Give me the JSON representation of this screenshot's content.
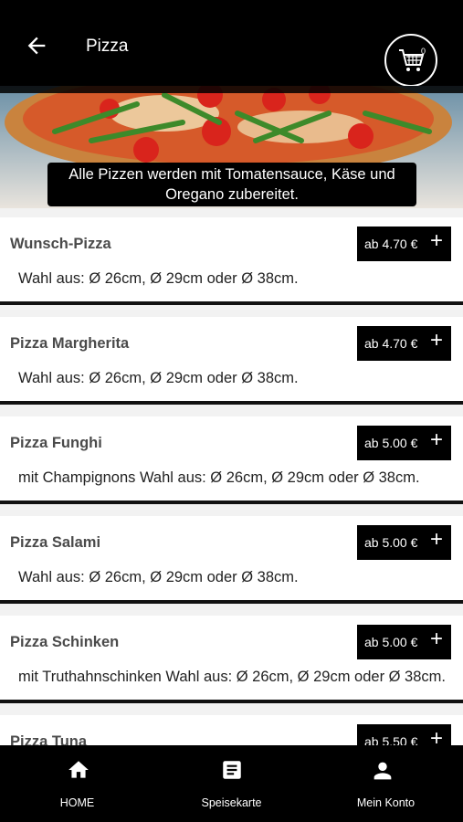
{
  "header": {
    "title": "Pizza",
    "cart_count": "0"
  },
  "banner": {
    "line1": "Alle Pizzen werden mit Tomatensauce, Käse und",
    "line2": "Oregano zubereitet."
  },
  "items": [
    {
      "name": "Wunsch-Pizza",
      "price": "ab 4.70 €",
      "description": "Wahl aus: Ø 26cm, Ø 29cm oder Ø 38cm."
    },
    {
      "name": "Pizza Margherita",
      "price": "ab 4.70 €",
      "description": "Wahl aus: Ø 26cm, Ø 29cm oder Ø 38cm."
    },
    {
      "name": "Pizza Funghi",
      "price": "ab 5.00 €",
      "description": "mit Champignons Wahl aus: Ø 26cm, Ø 29cm oder Ø 38cm."
    },
    {
      "name": "Pizza Salami",
      "price": "ab 5.00 €",
      "description": "Wahl aus: Ø 26cm, Ø 29cm oder Ø 38cm."
    },
    {
      "name": "Pizza Schinken",
      "price": "ab 5.00 €",
      "description": "mit Truthahnschinken Wahl aus: Ø 26cm, Ø 29cm oder Ø 38cm."
    },
    {
      "name": "Pizza Tuna",
      "price": "ab 5.50 €",
      "description": ""
    }
  ],
  "add_symbol": "+",
  "bottom_nav": [
    {
      "label": "HOME",
      "icon": "home-icon"
    },
    {
      "label": "Speisekarte",
      "icon": "menu-icon"
    },
    {
      "label": "Mein Konto",
      "icon": "account-icon"
    }
  ]
}
